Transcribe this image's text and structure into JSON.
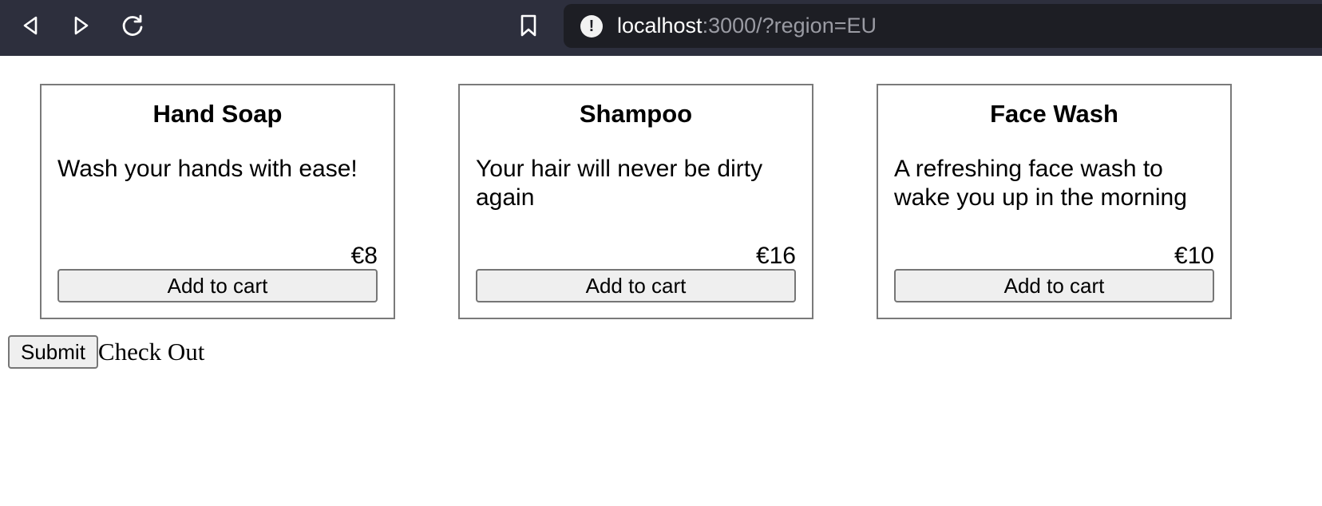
{
  "browser": {
    "url_host": "localhost",
    "url_rest": ":3000/?region=EU",
    "icons": {
      "back": "back-arrow-icon",
      "forward": "forward-arrow-icon",
      "reload": "reload-icon",
      "bookmark": "bookmark-icon",
      "site_info": "info-icon"
    },
    "colors": {
      "toolbar": "#2d2f3d",
      "urlbar": "#1d1e24"
    }
  },
  "products": [
    {
      "title": "Hand Soap",
      "description": "Wash your hands with ease!",
      "price": "€8",
      "button_label": "Add to cart"
    },
    {
      "title": "Shampoo",
      "description": "Your hair will never be dirty again",
      "price": "€16",
      "button_label": "Add to cart"
    },
    {
      "title": "Face Wash",
      "description": "A refreshing face wash to wake you up in the morning",
      "price": "€10",
      "button_label": "Add to cart"
    }
  ],
  "checkout": {
    "submit_label": "Submit",
    "label": "Check Out"
  }
}
